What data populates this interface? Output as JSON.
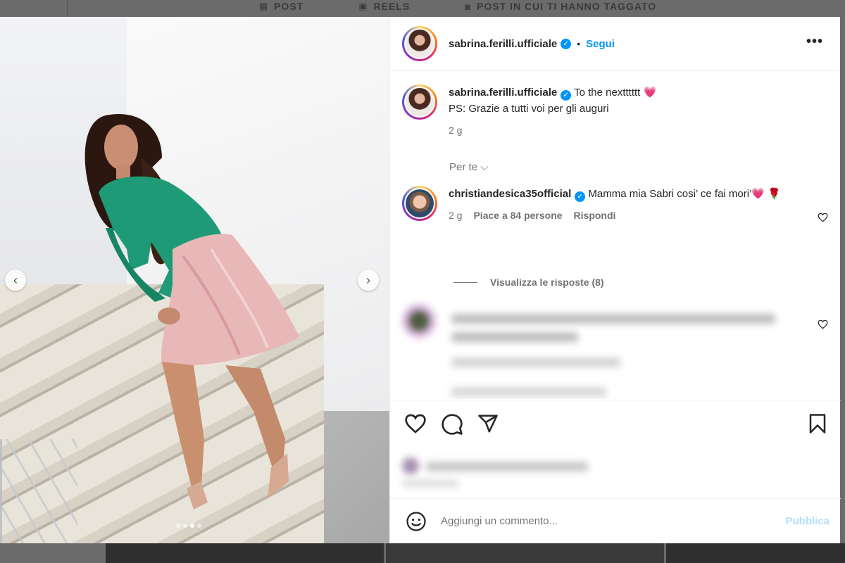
{
  "background_tabs": [
    {
      "icon": "grid-icon",
      "label": "POST"
    },
    {
      "icon": "reels-icon",
      "label": "REELS"
    },
    {
      "icon": "tagged-icon",
      "label": "POST IN CUI TI HANNO TAGGATO"
    }
  ],
  "post": {
    "author": "sabrina.ferilli.ufficiale",
    "separator": "•",
    "follow_label": "Segui",
    "more_label": "•••",
    "caption_line1": "To the nextttttt",
    "caption_emoji": "💗",
    "caption_line2": "PS: Grazie a tutti voi per gli auguri",
    "caption_time": "2 g",
    "carousel_total": 4,
    "carousel_active": 3
  },
  "sort_label": "Per te",
  "comments": [
    {
      "author": "christiandesica35official",
      "text": "Mamma mia Sabri cosi’ ce fai mori’",
      "emoji": "💗 🌹",
      "time": "2 g",
      "likes": "Piace a 84 persone",
      "reply": "Rispondi",
      "view_replies": "Visualizza le risposte (8)"
    }
  ],
  "comment_box": {
    "placeholder": "Aggiungi un commento...",
    "publish": "Pubblica"
  },
  "colors": {
    "accent": "#0095f6",
    "publish_disabled": "#b2dffc",
    "text": "#262626",
    "secondary": "#737373"
  }
}
